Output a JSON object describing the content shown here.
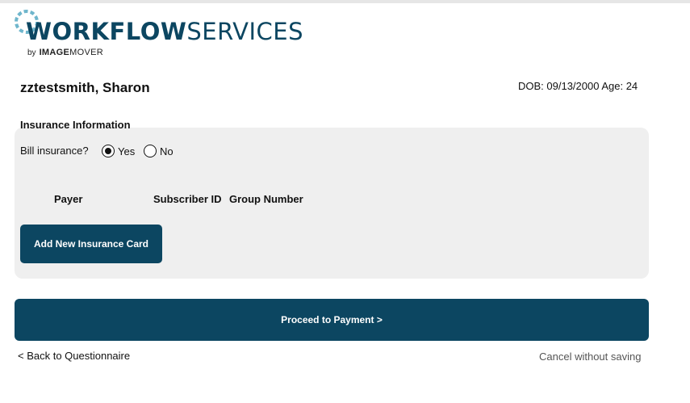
{
  "brand": {
    "title_bold": "WORKFLOW",
    "title_light": "SERVICES",
    "by": "by",
    "sub_bold": "IMAGE",
    "sub_light": "MOVER",
    "color": "#0c4661",
    "mark_icon": "dotted-ring-icon"
  },
  "patient": {
    "name": "zztestsmith, Sharon",
    "meta": "DOB: 09/13/2000 Age: 24"
  },
  "insurance": {
    "section_title": "Insurance Information",
    "bill_label": "Bill insurance?",
    "options": [
      {
        "label": "Yes",
        "selected": true
      },
      {
        "label": "No",
        "selected": false
      }
    ],
    "columns": [
      "Payer",
      "Subscriber ID",
      "Group Number"
    ],
    "add_button": "Add New Insurance Card"
  },
  "actions": {
    "proceed": "Proceed to Payment >",
    "back": "< Back to Questionnaire",
    "cancel": "Cancel without saving"
  },
  "colors": {
    "primary": "#0c4661",
    "panel_bg": "#efefef"
  }
}
